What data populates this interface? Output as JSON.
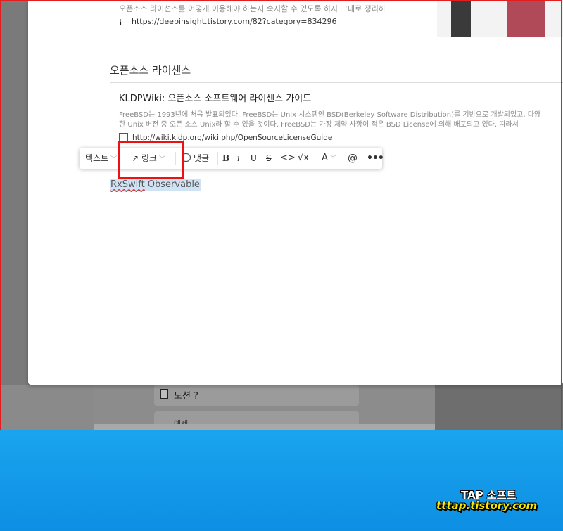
{
  "background": {
    "items": [
      {
        "label": "노션 ?"
      },
      {
        "label": "예제"
      }
    ]
  },
  "editor": {
    "card1": {
      "description": "오픈소스 라이선스를 어떻게 이용해야 하는지 숙지할 수 있도록 하자 그대로 정리하",
      "url": "https://deepinsight.tistory.com/82?category=834296",
      "site_icon": "tistory-icon"
    },
    "heading": "오픈소스 라이센스",
    "card2": {
      "title": "KLDPWiki: 오픈소스 소프트웨어 라이센스 가이드",
      "desc_line1": "FreeBSD는 1993년에 처음 발표되었다. FreeBSD는 Unix 시스템인 BSD(Berkeley Software Distribution)를 기반으로 개발되었고, 다양",
      "desc_line2": "한 Unix 버전 중 오픈 소스 Unix라 할 수 있을 것이다. FreeBSD는 가장 제약 사항이 적은 BSD License에 의해 배포되고 있다. 따라서",
      "url": "http://wiki.kldp.org/wiki.php/OpenSourceLicenseGuide",
      "file_icon": "file-icon"
    },
    "selected_text": {
      "part1": "RxSwift",
      "part2": " Observable"
    }
  },
  "toolbar": {
    "text_style": "텍스트",
    "link": "링크",
    "link_arrow": "↗",
    "comment": "댓글",
    "bold": "B",
    "italic": "i",
    "underline": "U",
    "strike": "S",
    "code": "<>",
    "math": "√x",
    "color": "A",
    "mention": "@",
    "more": "•••",
    "chevron": "﹀"
  },
  "watermark": {
    "line1": "TAP 소프트",
    "line2": "tttap.tistory.com"
  },
  "colors": {
    "highlight_border": "#ee1111",
    "selection": "#cfe3f5",
    "taskbar": "#0d8fe3"
  }
}
